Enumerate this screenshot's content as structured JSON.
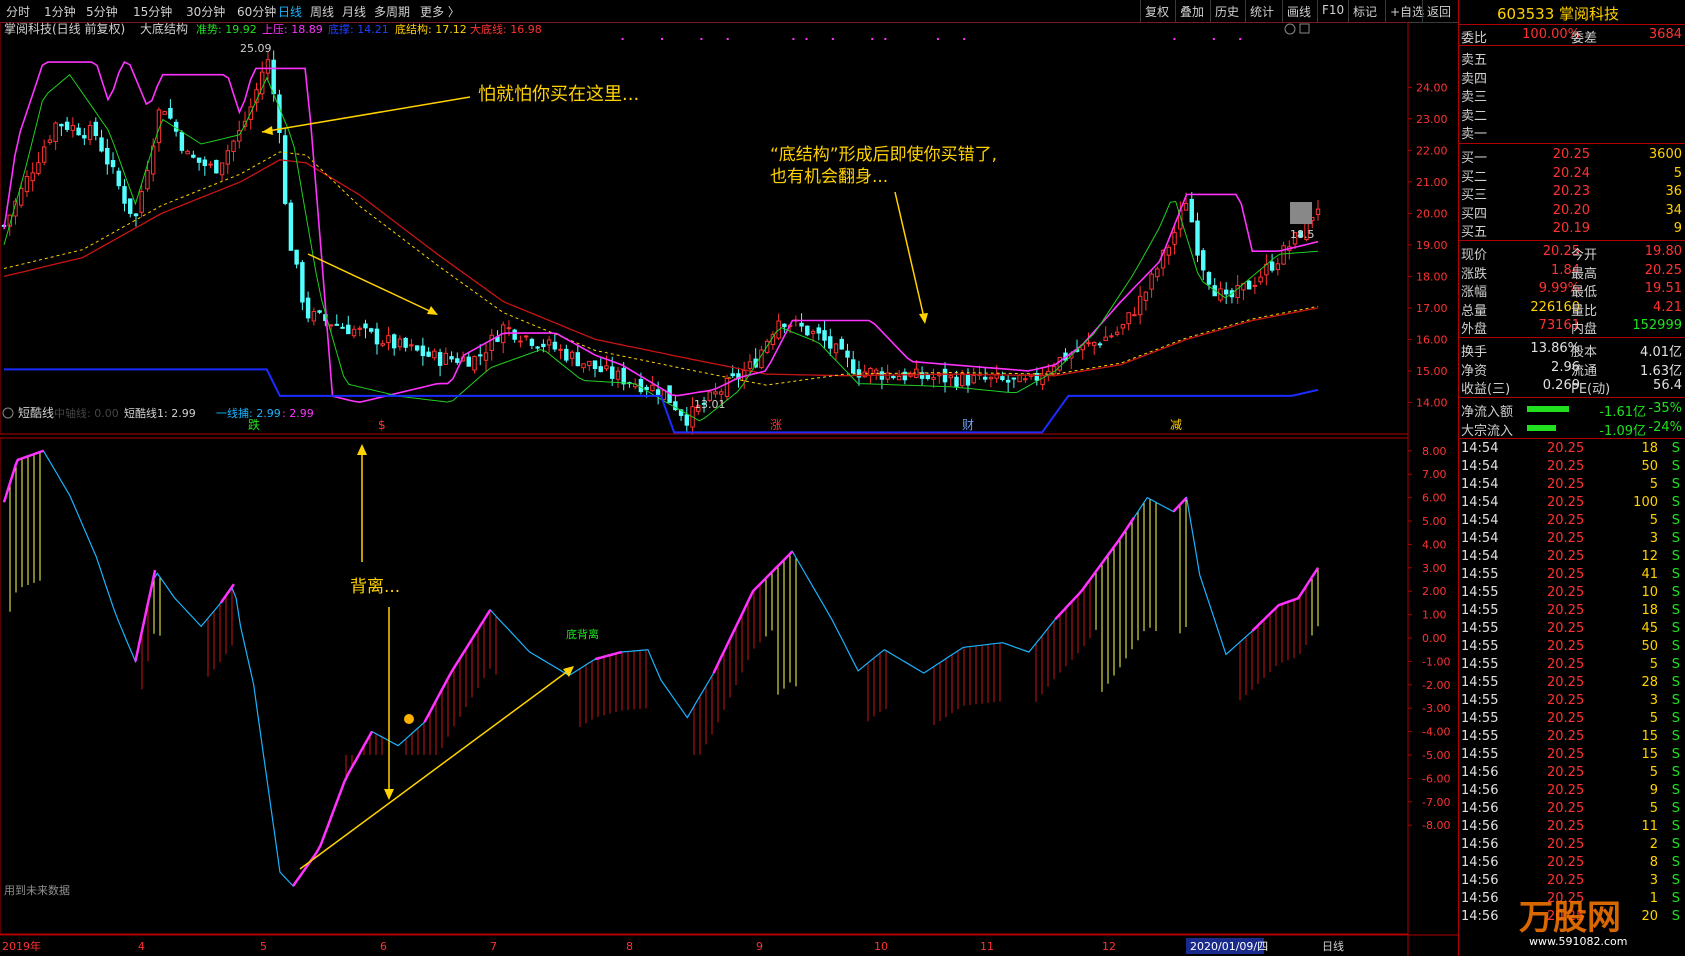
{
  "toolbar": {
    "left": [
      "分时",
      "1分钟",
      "5分钟",
      "15分钟",
      "30分钟",
      "60分钟",
      "日线",
      "周线",
      "月线",
      "多周期",
      "更多 〉"
    ],
    "right": [
      "复权",
      "叠加",
      "历史",
      "统计",
      "画线",
      "F10",
      "标记",
      "+自选",
      "返回"
    ]
  },
  "upper": {
    "stock_title": "掌阅科技(日线 前复权)",
    "indicator_name": "大底结构",
    "legend": [
      {
        "text": "准势: 19.92",
        "color": "#20e020"
      },
      {
        "text": "上压: 18.89",
        "color": "#ff32ff"
      },
      {
        "text": "底撑: 14.21",
        "color": "#2040ff"
      },
      {
        "text": "底结构: 17.12",
        "color": "#ffd200"
      },
      {
        "text": "大底线: 16.98",
        "color": "#ff3232"
      }
    ],
    "yaxis": [
      "24.00",
      "23.00",
      "22.00",
      "21.00",
      "20.00",
      "19.00",
      "18.00",
      "17.00",
      "16.00",
      "15.00",
      "14.00"
    ],
    "ylim": [
      13.0,
      25.5
    ],
    "annot_high": "25.09",
    "annot_low": "13.01",
    "annot_last": "18.5",
    "callout1": "怕就怕你买在这里...",
    "callout2_line1": "“底结构”形成后即使你买错了,",
    "callout2_line2": "也有机会翻身...",
    "signals": [
      {
        "text": "跌",
        "color": "#20e020"
      },
      {
        "text": "$",
        "color": "#ff3232"
      },
      {
        "text": "涨",
        "color": "#ff3232"
      },
      {
        "text": "财",
        "color": "#6da0ff"
      },
      {
        "text": "减",
        "color": "#ffd200"
      }
    ]
  },
  "lower": {
    "indicator_name": "短酷线",
    "legend": [
      {
        "text": "中轴线: 0.00",
        "color": "#444444"
      },
      {
        "text": "短酷线1: 2.99",
        "color": "#d0d0d0"
      },
      {
        "text": "一线捕: 2.99",
        "color": "#19b4ff"
      },
      {
        "text": ": 2.99",
        "color": "#ff32ff"
      }
    ],
    "yaxis": [
      "8.00",
      "7.00",
      "6.00",
      "5.00",
      "4.00",
      "3.00",
      "2.00",
      "1.00",
      "0.00",
      "-1.00",
      "-2.00",
      "-3.00",
      "-4.00",
      "-5.00",
      "-6.00",
      "-7.00",
      "-8.00"
    ],
    "callout": "背离...",
    "tag": "底背离",
    "footnote": "用到未来数据"
  },
  "xaxis": {
    "labels": [
      "2019年",
      "4",
      "5",
      "6",
      "7",
      "8",
      "9",
      "10",
      "11",
      "12"
    ],
    "date_box": "2020/01/09/四",
    "period": "日线"
  },
  "quote": {
    "code_name": "603533 掌阅科技",
    "weibi_label": "委比",
    "weibi": "100.00%",
    "weicha_label": "委差",
    "weicha": "3684",
    "sells": [
      {
        "label": "卖五",
        "price": "",
        "vol": ""
      },
      {
        "label": "卖四",
        "price": "",
        "vol": ""
      },
      {
        "label": "卖三",
        "price": "",
        "vol": ""
      },
      {
        "label": "卖二",
        "price": "",
        "vol": ""
      },
      {
        "label": "卖一",
        "price": "",
        "vol": ""
      }
    ],
    "buys": [
      {
        "label": "买一",
        "price": "20.25",
        "vol": "3600"
      },
      {
        "label": "买二",
        "price": "20.24",
        "vol": "5"
      },
      {
        "label": "买三",
        "price": "20.23",
        "vol": "36"
      },
      {
        "label": "买四",
        "price": "20.20",
        "vol": "34"
      },
      {
        "label": "买五",
        "price": "20.19",
        "vol": "9"
      }
    ],
    "stats": [
      {
        "l1": "现价",
        "v1": "20.25",
        "c1": "red",
        "l2": "今开",
        "v2": "19.80",
        "c2": "red"
      },
      {
        "l1": "涨跌",
        "v1": "1.84",
        "c1": "red",
        "l2": "最高",
        "v2": "20.25",
        "c2": "red"
      },
      {
        "l1": "涨幅",
        "v1": "9.99%",
        "c1": "red",
        "l2": "最低",
        "v2": "19.51",
        "c2": "red"
      },
      {
        "l1": "总量",
        "v1": "226160",
        "c1": "yel",
        "l2": "量比",
        "v2": "4.21",
        "c2": "red"
      },
      {
        "l1": "外盘",
        "v1": "73161",
        "c1": "red",
        "l2": "内盘",
        "v2": "152999",
        "c2": "grn"
      }
    ],
    "stats2": [
      {
        "l1": "换手",
        "v1": "13.86%",
        "l2": "股本",
        "v2": "4.01亿"
      },
      {
        "l1": "净资",
        "v1": "2.96",
        "l2": "流通",
        "v2": "1.63亿"
      },
      {
        "l1": "收益(三)",
        "v1": "0.269",
        "l2": "PE(动)",
        "v2": "56.4"
      }
    ],
    "flows": [
      {
        "label": "净流入额",
        "value": "-1.61亿",
        "pct": "-35%",
        "bar": 0.35
      },
      {
        "label": "大宗流入",
        "value": "-1.09亿",
        "pct": "-24%",
        "bar": 0.24
      }
    ],
    "ticks": [
      [
        "14:54",
        "20.25",
        "18",
        "S"
      ],
      [
        "14:54",
        "20.25",
        "50",
        "S"
      ],
      [
        "14:54",
        "20.25",
        "5",
        "S"
      ],
      [
        "14:54",
        "20.25",
        "100",
        "S"
      ],
      [
        "14:54",
        "20.25",
        "5",
        "S"
      ],
      [
        "14:54",
        "20.25",
        "3",
        "S"
      ],
      [
        "14:54",
        "20.25",
        "12",
        "S"
      ],
      [
        "14:55",
        "20.25",
        "41",
        "S"
      ],
      [
        "14:55",
        "20.25",
        "10",
        "S"
      ],
      [
        "14:55",
        "20.25",
        "18",
        "S"
      ],
      [
        "14:55",
        "20.25",
        "45",
        "S"
      ],
      [
        "14:55",
        "20.25",
        "50",
        "S"
      ],
      [
        "14:55",
        "20.25",
        "5",
        "S"
      ],
      [
        "14:55",
        "20.25",
        "28",
        "S"
      ],
      [
        "14:55",
        "20.25",
        "3",
        "S"
      ],
      [
        "14:55",
        "20.25",
        "5",
        "S"
      ],
      [
        "14:55",
        "20.25",
        "15",
        "S"
      ],
      [
        "14:55",
        "20.25",
        "15",
        "S"
      ],
      [
        "14:56",
        "20.25",
        "5",
        "S"
      ],
      [
        "14:56",
        "20.25",
        "9",
        "S"
      ],
      [
        "14:56",
        "20.25",
        "5",
        "S"
      ],
      [
        "14:56",
        "20.25",
        "11",
        "S"
      ],
      [
        "14:56",
        "20.25",
        "2",
        "S"
      ],
      [
        "14:56",
        "20.25",
        "8",
        "S"
      ],
      [
        "14:56",
        "20.25",
        "3",
        "S"
      ],
      [
        "14:56",
        "20.25",
        "1",
        "S"
      ],
      [
        "14:56",
        "20.25",
        "20",
        "S"
      ]
    ],
    "watermark": "万股网",
    "watermark_url": "www.591082.com"
  },
  "colors": {
    "up": "#ff3232",
    "down": "#54ffff",
    "ma": "#c81414",
    "support": "#1a2cff",
    "pressure": "#ff32ff",
    "trend": "#20d020",
    "dashed": "#ffd200"
  }
}
